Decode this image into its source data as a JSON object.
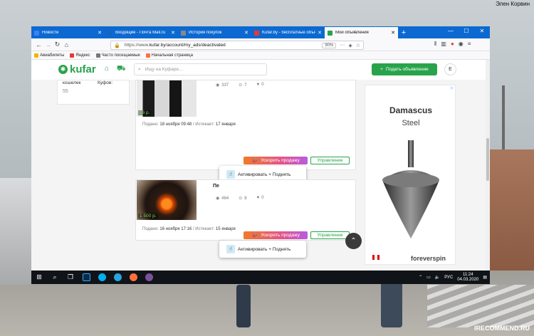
{
  "desktop": {
    "user_name": "Элен Корвин",
    "watermark": "IRECOMMEND.RU"
  },
  "browser": {
    "tabs": [
      {
        "label": "Новости",
        "icon": "globe-icon",
        "color": "#3b82f6",
        "active": false
      },
      {
        "label": "Входящие - Почта Mail.ru",
        "icon": "mail-icon",
        "color": "#1565c0",
        "active": false
      },
      {
        "label": "История покупок",
        "icon": "page-icon",
        "color": "#888888",
        "active": false
      },
      {
        "label": "Kufar.by - бесплатные объявл",
        "icon": "kufar-icon",
        "color": "#e53935",
        "active": false
      },
      {
        "label": "Мои объявления",
        "icon": "kufar-green-icon",
        "color": "#29a34b",
        "active": true
      }
    ],
    "new_tab": "+",
    "url_prefix": "https://www.",
    "url": "kufar.by/account/my_ads/deactivated",
    "zoom": "90%",
    "bookmarks": [
      {
        "label": "Авиабилеты",
        "color": "#f4b400"
      },
      {
        "label": "Яндекс",
        "color": "#e53935"
      },
      {
        "label": "Часто посещаемые",
        "color": "#777777"
      },
      {
        "label": "Начальная страница",
        "color": "#ff7043"
      }
    ]
  },
  "kufar": {
    "logo": "kufar",
    "search_placeholder": "Ищу на Куфаре...",
    "post_button": "Подать объявление",
    "avatar_letter": "E",
    "sidebar": {
      "line1": "кошелек",
      "line2": "Куфов:",
      "balance": "55"
    },
    "ads": [
      {
        "title": "",
        "price": "16 р.",
        "views": "337",
        "favorites": "7",
        "likes": "0",
        "posted_label": "Подано:",
        "posted": "18 ноября 09:48",
        "expires_label": "/ Истекает:",
        "expires": "17 января",
        "boost_button": "Ускорить продажу",
        "manage_button": "Управление",
        "popup": "Активировать + Поднять"
      },
      {
        "title": "Пе",
        "price": "1 500 р.",
        "views": "464",
        "favorites": "8",
        "likes": "0",
        "posted_label": "Подано:",
        "posted": "16 ноября 17:16",
        "expires_label": "/ Истекает:",
        "expires": "15 января",
        "boost_button": "Ускорить продажу",
        "manage_button": "Управление",
        "popup": "Активировать + Поднять"
      }
    ],
    "ad_banner": {
      "brand": "Damascus",
      "sub": "Steel",
      "footer": "foreverspin"
    }
  },
  "taskbar": {
    "lang": "РУС",
    "time": "11:24",
    "date": "04.03.2020"
  }
}
